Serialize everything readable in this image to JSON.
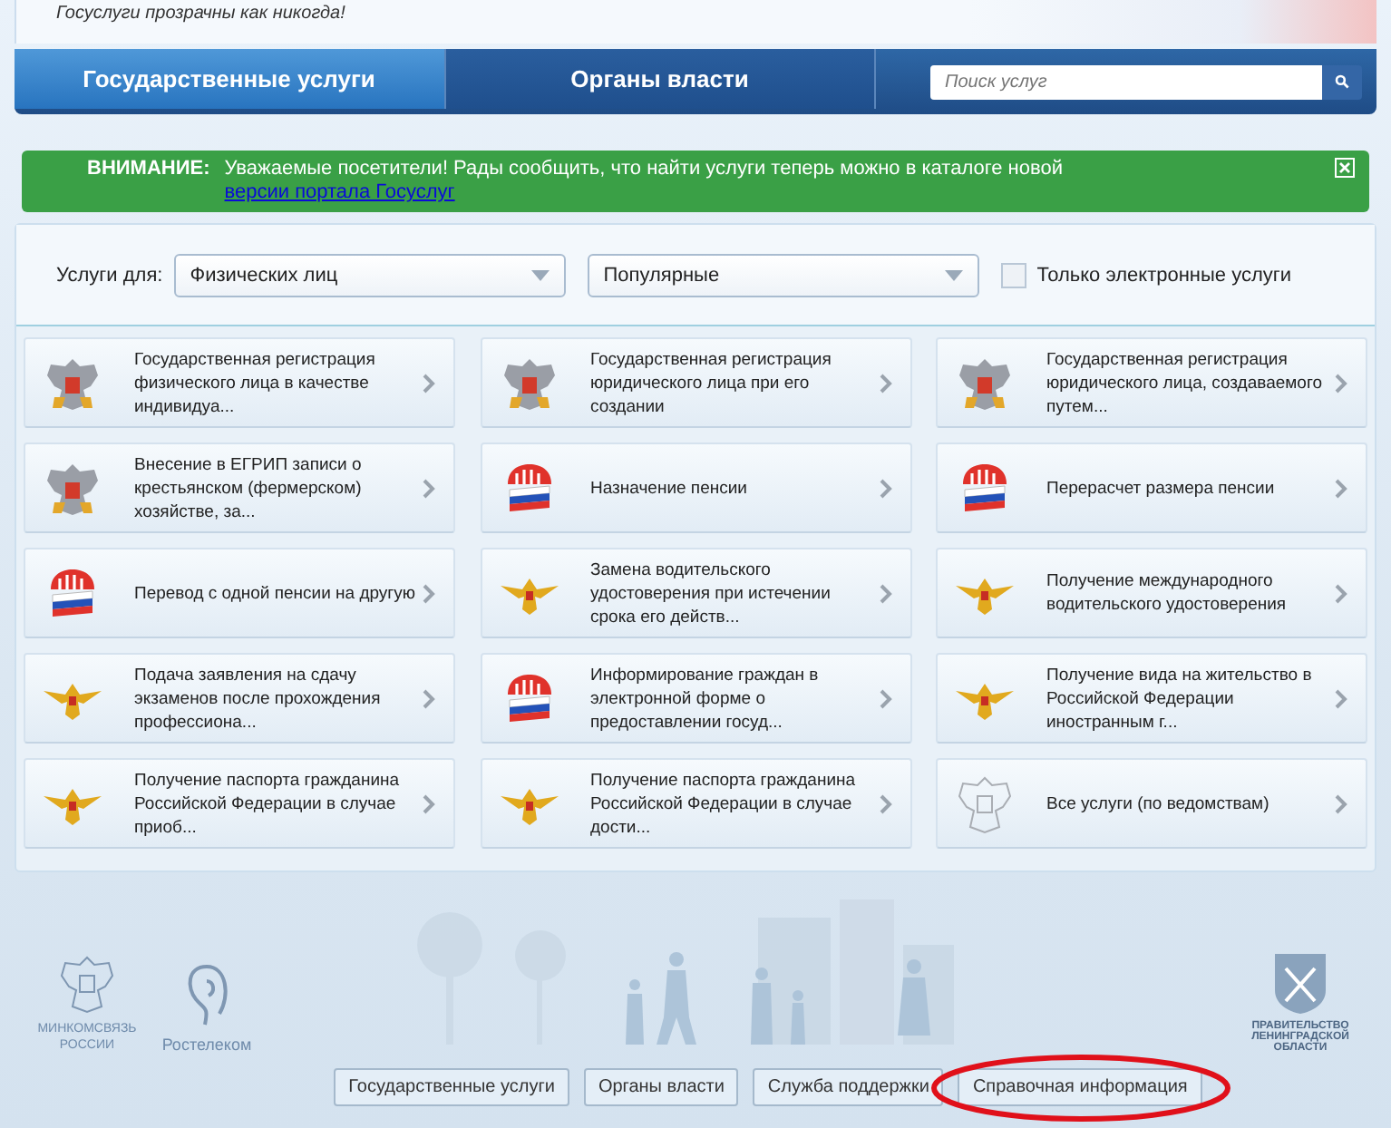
{
  "header": {
    "tagline": "Госуслуги прозрачны как никогда!"
  },
  "nav": {
    "tabs": [
      {
        "label": "Государственные услуги",
        "selected": true
      },
      {
        "label": "Органы власти",
        "selected": false
      }
    ],
    "search": {
      "placeholder": "Поиск услуг"
    }
  },
  "notice": {
    "label": "ВНИМАНИЕ:",
    "text": "Уважаемые посетители! Рады сообщить, что найти услуги теперь можно в каталоге новой ",
    "link": "версии портала Госуслуг"
  },
  "filters": {
    "label": "Услуги для:",
    "audience": "Физических лиц",
    "sort": "Популярные",
    "electronic_only": {
      "label": "Только электронные услуги",
      "checked": false
    }
  },
  "services": [
    {
      "kind": "emblem",
      "title": "Государственная регистрация физического лица в качестве индивидуа..."
    },
    {
      "kind": "emblem",
      "title": "Государственная регистрация юридического лица при его создании"
    },
    {
      "kind": "emblem",
      "title": "Государственная регистрация юридического лица, создаваемого путем..."
    },
    {
      "kind": "emblem",
      "title": "Внесение в ЕГРИП записи о крестьянском (фермерском) хозяйстве, за..."
    },
    {
      "kind": "pension",
      "title": "Назначение пенсии"
    },
    {
      "kind": "pension",
      "title": "Перерасчет размера пенсии"
    },
    {
      "kind": "pension",
      "title": "Перевод с одной пенсии на другую"
    },
    {
      "kind": "eagle",
      "title": "Замена водительского удостоверения при истечении срока его действ..."
    },
    {
      "kind": "eagle",
      "title": "Получение международного водительского удостоверения"
    },
    {
      "kind": "eagle",
      "title": "Подача заявления на сдачу экзаменов после прохождения профессиона..."
    },
    {
      "kind": "pension",
      "title": "Информирование граждан в электронной форме о предоставлении госуд..."
    },
    {
      "kind": "eagle",
      "title": "Получение вида на жительство в Российской Федерации иностранным г..."
    },
    {
      "kind": "eagle",
      "title": "Получение паспорта гражданина Российской Федерации в случае приоб..."
    },
    {
      "kind": "eagle",
      "title": "Получение паспорта гражданина Российской Федерации в случае дости..."
    },
    {
      "kind": "outline",
      "title": "Все услуги (по ведомствам)"
    }
  ],
  "footer": {
    "partners": [
      {
        "kind": "ministry",
        "name": "МИНКОМСВЯЗЬ РОССИИ"
      },
      {
        "kind": "telecom",
        "name": "Ростелеком"
      }
    ],
    "region": "ПРАВИТЕЛЬСТВО ЛЕНИНГРАДСКОЙ ОБЛАСТИ",
    "links": [
      "Государственные услуги",
      "Органы власти",
      "Служба поддержки",
      "Справочная информация"
    ]
  }
}
